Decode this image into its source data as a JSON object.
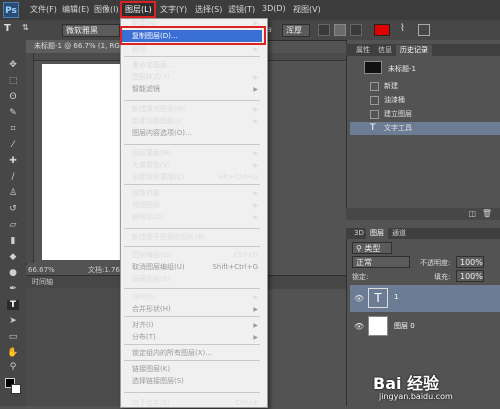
{
  "app": {
    "logo": "Ps"
  },
  "menubar": {
    "items": [
      "文件(F)",
      "编辑(E)",
      "图像(I)",
      "图层(L)",
      "文字(Y)",
      "选择(S)",
      "滤镜(T)",
      "3D(D)",
      "视图(V)"
    ]
  },
  "options": {
    "font_family": "微软雅黑",
    "font_style": "-",
    "font_size": "72点",
    "antialias_label": "aa",
    "antialias": "浑厚",
    "color": "#e00000"
  },
  "document": {
    "tab_title": "未标题-1 @ 66.7% (1, RGB",
    "zoom": "66.67%",
    "doc_info": "文档:1.76M",
    "timeline_label": "时间轴"
  },
  "layer_menu": {
    "items": [
      {
        "label": "新建(N)",
        "shortcut": "",
        "arrow": true,
        "disabled": false
      },
      {
        "label": "复制图层(D)...",
        "shortcut": "",
        "arrow": false,
        "disabled": false
      },
      {
        "label": "删除",
        "shortcut": "",
        "arrow": true,
        "disabled": false
      },
      {
        "label": "重命名图层...",
        "shortcut": "",
        "arrow": false,
        "disabled": false
      },
      {
        "label": "图层样式(Y)",
        "shortcut": "",
        "arrow": true,
        "disabled": false
      },
      {
        "label": "智能滤镜",
        "shortcut": "",
        "arrow": true,
        "disabled": true
      },
      {
        "label": "新建填充图层(W)",
        "shortcut": "",
        "arrow": true,
        "disabled": false
      },
      {
        "label": "新建调整图层(J)",
        "shortcut": "",
        "arrow": true,
        "disabled": false
      },
      {
        "label": "图层内容选项(O)...",
        "shortcut": "",
        "arrow": false,
        "disabled": true
      },
      {
        "label": "图层蒙版(M)",
        "shortcut": "",
        "arrow": true,
        "disabled": false
      },
      {
        "label": "矢量蒙版(V)",
        "shortcut": "",
        "arrow": true,
        "disabled": false
      },
      {
        "label": "创建剪贴蒙版(C)",
        "shortcut": "Alt+Ctrl+G",
        "arrow": false,
        "disabled": false
      },
      {
        "label": "智能对象",
        "shortcut": "",
        "arrow": true,
        "disabled": false
      },
      {
        "label": "视频图层",
        "shortcut": "",
        "arrow": true,
        "disabled": false
      },
      {
        "label": "栅格化(Z)",
        "shortcut": "",
        "arrow": true,
        "disabled": false
      },
      {
        "label": "新建基于图层的切片(B)",
        "shortcut": "",
        "arrow": false,
        "disabled": false
      },
      {
        "label": "图层编组(G)",
        "shortcut": "Ctrl+G",
        "arrow": false,
        "disabled": false
      },
      {
        "label": "取消图层编组(U)",
        "shortcut": "Shift+Ctrl+G",
        "arrow": false,
        "disabled": true
      },
      {
        "label": "隐藏图层(R)",
        "shortcut": "",
        "arrow": false,
        "disabled": false
      },
      {
        "label": "排列(A)",
        "shortcut": "",
        "arrow": true,
        "disabled": false
      },
      {
        "label": "合并形状(H)",
        "shortcut": "",
        "arrow": true,
        "disabled": true
      },
      {
        "label": "对齐(I)",
        "shortcut": "",
        "arrow": true,
        "disabled": true
      },
      {
        "label": "分布(T)",
        "shortcut": "",
        "arrow": true,
        "disabled": true
      },
      {
        "label": "锁定组内的所有图层(X)...",
        "shortcut": "",
        "arrow": false,
        "disabled": true
      },
      {
        "label": "链接图层(K)",
        "shortcut": "",
        "arrow": false,
        "disabled": true
      },
      {
        "label": "选择链接图层(S)",
        "shortcut": "",
        "arrow": false,
        "disabled": true
      },
      {
        "label": "向下合并(E)",
        "shortcut": "Ctrl+E",
        "arrow": false,
        "disabled": false
      }
    ]
  },
  "history_panel": {
    "tabs": [
      "属性",
      "信息",
      "历史记录"
    ],
    "snapshot": "未标题-1",
    "steps": [
      "新建",
      "油漆桶",
      "建立图层",
      "文字工具"
    ]
  },
  "layers_panel": {
    "tabs": [
      "3D",
      "图层",
      "通道"
    ],
    "filter_kind": "类型",
    "blend_mode": "正常",
    "opacity_label": "不透明度:",
    "opacity": "100%",
    "lock_label": "锁定:",
    "fill_label": "填充:",
    "fill": "100%",
    "layers": [
      {
        "name": "1",
        "type": "text"
      },
      {
        "name": "图层 0",
        "type": "pixel"
      }
    ]
  },
  "watermark": {
    "logo_text": "Bai 经验",
    "url": "jingyan.baidu.com"
  }
}
